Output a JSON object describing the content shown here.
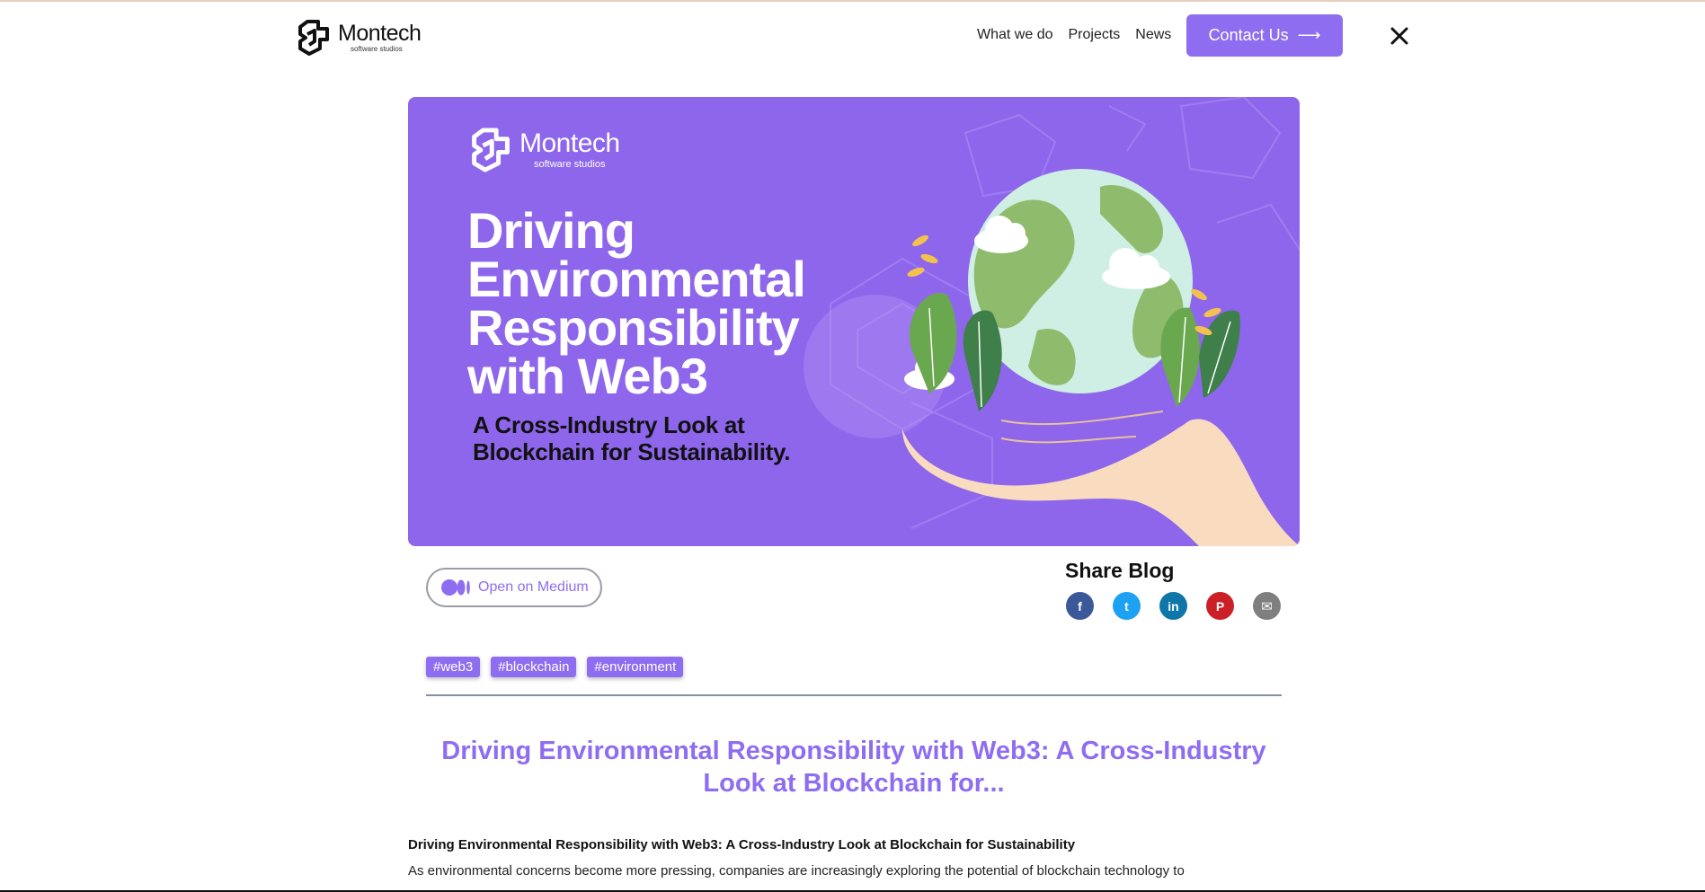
{
  "header": {
    "logo_name": "Montech",
    "logo_sub": "software studios",
    "nav": [
      "What we do",
      "Projects",
      "News"
    ],
    "contact_label": "Contact Us",
    "contact_arrow": "⟶",
    "close_icon": "close-icon"
  },
  "hero": {
    "logo_name": "Montech",
    "logo_sub": "software studios",
    "title_lines": [
      "Driving",
      "Environmental",
      "Responsibility",
      "with Web3"
    ],
    "subtitle_lines": [
      "A Cross-Industry Look at",
      "Blockchain for Sustainability."
    ],
    "background_color": "#8e66ec"
  },
  "medium": {
    "label": "Open on Medium"
  },
  "share": {
    "title": "Share Blog",
    "icons": [
      {
        "name": "facebook-icon",
        "glyph": "f",
        "color": "#3b5998"
      },
      {
        "name": "twitter-icon",
        "glyph": "t",
        "color": "#1da1f2"
      },
      {
        "name": "linkedin-icon",
        "glyph": "in",
        "color": "#0e76a8"
      },
      {
        "name": "pinterest-icon",
        "glyph": "P",
        "color": "#cb2027"
      },
      {
        "name": "email-icon",
        "glyph": "✉",
        "color": "#7f7f7f"
      }
    ]
  },
  "tags": [
    "#web3",
    "#blockchain",
    "#environment"
  ],
  "article": {
    "title": "Driving Environmental Responsibility with Web3: A Cross-Industry Look at Blockchain for...",
    "lead": "Driving Environmental Responsibility with Web3: A Cross-Industry Look at Blockchain for Sustainability",
    "body": "As environmental concerns become more pressing, companies are increasingly exploring the potential of blockchain technology to"
  },
  "colors": {
    "accent": "#8f6df0"
  }
}
